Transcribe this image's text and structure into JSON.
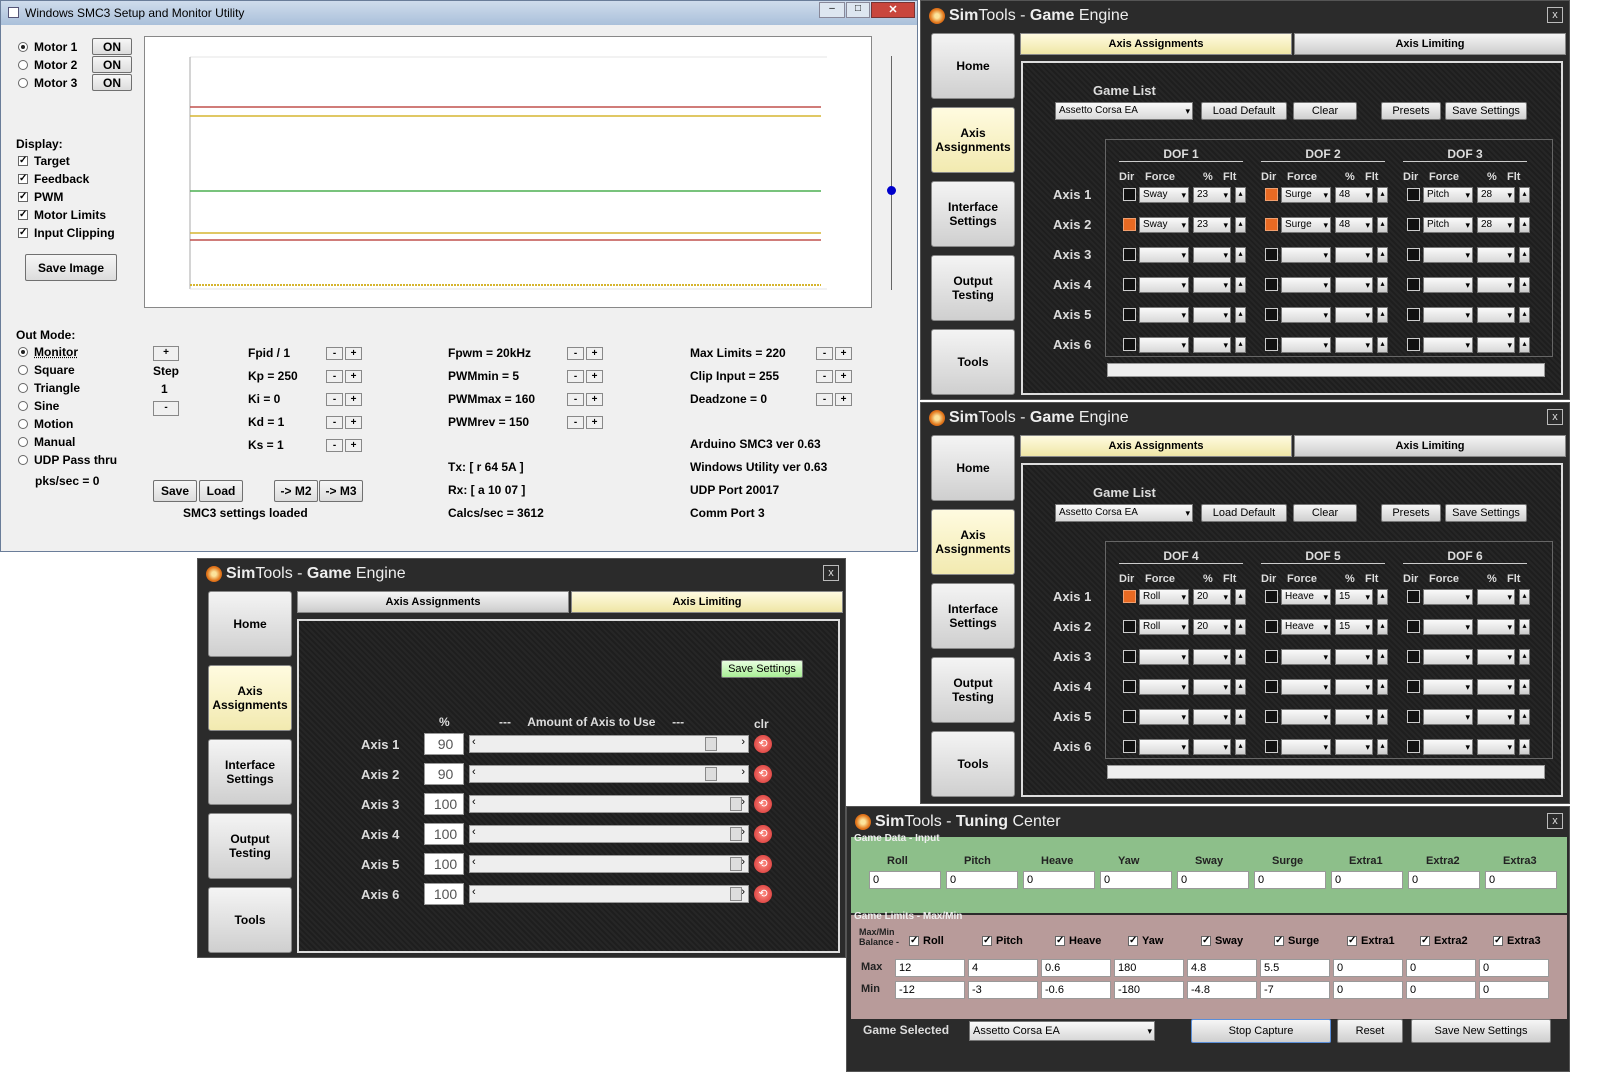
{
  "smc3": {
    "title": "Windows SMC3 Setup and Monitor Utility",
    "motors": [
      {
        "label": "Motor 1",
        "state": "ON",
        "selected": true
      },
      {
        "label": "Motor 2",
        "state": "ON",
        "selected": false
      },
      {
        "label": "Motor 3",
        "state": "ON",
        "selected": false
      }
    ],
    "display_label": "Display:",
    "display_opts": [
      {
        "label": "Target",
        "checked": true
      },
      {
        "label": "Feedback",
        "checked": true
      },
      {
        "label": "PWM",
        "checked": true
      },
      {
        "label": "Motor Limits",
        "checked": true
      },
      {
        "label": "Input Clipping",
        "checked": true
      }
    ],
    "save_image": "Save Image",
    "out_mode_label": "Out Mode:",
    "out_modes": [
      {
        "label": "Monitor",
        "selected": true
      },
      {
        "label": "Square",
        "selected": false
      },
      {
        "label": "Triangle",
        "selected": false
      },
      {
        "label": "Sine",
        "selected": false
      },
      {
        "label": "Motion",
        "selected": false
      },
      {
        "label": "Manual",
        "selected": false
      },
      {
        "label": "UDP Pass thru",
        "selected": false
      }
    ],
    "pks": "pks/sec = 0",
    "step_label": "Step",
    "step_value": "1",
    "plus": "+",
    "minus": "-",
    "params_col1": [
      "Fpid / 1",
      "Kp = 250",
      "Ki = 0",
      "Kd = 1",
      "Ks = 1"
    ],
    "params_col2": [
      "Fpwm = 20kHz",
      "PWMmin = 5",
      "PWMmax = 160",
      "PWMrev = 150"
    ],
    "params_col3": [
      "Max Limits = 220",
      "Clip Input = 255",
      "Deadzone = 0"
    ],
    "info_col2": [
      "Tx: [ r 64 5A ]",
      "Rx: [ a 10 07 ]",
      "Calcs/sec = 3612"
    ],
    "info_col3": [
      "Arduino SMC3 ver 0.63",
      "Windows Utility ver 0.63",
      "UDP Port 20017",
      "Comm Port 3"
    ],
    "buttons": {
      "save": "Save",
      "load": "Load",
      "m2": "-> M2",
      "m3": "-> M3"
    },
    "status": "SMC3 settings loaded",
    "line_colors": {
      "red": "#c0504d",
      "yellow": "#d6b530",
      "green": "#4caf50",
      "slider": "#0000cc"
    }
  },
  "st_common": {
    "title_sim": "Sim",
    "title_tools": "Tools - ",
    "title_game": "Game",
    "title_engine": " Engine",
    "close": "x",
    "nav": [
      "Home",
      "Axis\nAssignments",
      "Interface\nSettings",
      "Output\nTesting",
      "Tools"
    ],
    "tabs": [
      "Axis Assignments",
      "Axis Limiting"
    ],
    "game_list": "Game List",
    "game": "Assetto Corsa EA",
    "load_default": "Load Default",
    "clear": "Clear",
    "presets": "Presets",
    "save_settings": "Save Settings",
    "col_heads": {
      "dir": "Dir",
      "force": "Force",
      "pct": "%",
      "flt": "Flt"
    },
    "axes": [
      "Axis 1",
      "Axis 2",
      "Axis 3",
      "Axis 4",
      "Axis 5",
      "Axis 6"
    ]
  },
  "st1": {
    "dofs": [
      "DOF 1",
      "DOF 2",
      "DOF 3"
    ],
    "rows": [
      [
        {
          "on": false,
          "f": "Sway",
          "p": "23"
        },
        {
          "on": true,
          "f": "Surge",
          "p": "48"
        },
        {
          "on": false,
          "f": "Pitch",
          "p": "28"
        }
      ],
      [
        {
          "on": true,
          "f": "Sway",
          "p": "23"
        },
        {
          "on": true,
          "f": "Surge",
          "p": "48"
        },
        {
          "on": false,
          "f": "Pitch",
          "p": "28"
        }
      ],
      [
        {
          "on": false,
          "f": "",
          "p": ""
        },
        {
          "on": false,
          "f": "",
          "p": ""
        },
        {
          "on": false,
          "f": "",
          "p": ""
        }
      ],
      [
        {
          "on": false,
          "f": "",
          "p": ""
        },
        {
          "on": false,
          "f": "",
          "p": ""
        },
        {
          "on": false,
          "f": "",
          "p": ""
        }
      ],
      [
        {
          "on": false,
          "f": "",
          "p": ""
        },
        {
          "on": false,
          "f": "",
          "p": ""
        },
        {
          "on": false,
          "f": "",
          "p": ""
        }
      ],
      [
        {
          "on": false,
          "f": "",
          "p": ""
        },
        {
          "on": false,
          "f": "",
          "p": ""
        },
        {
          "on": false,
          "f": "",
          "p": ""
        }
      ]
    ]
  },
  "st2": {
    "dofs": [
      "DOF 4",
      "DOF 5",
      "DOF 6"
    ],
    "rows": [
      [
        {
          "on": true,
          "f": "Roll",
          "p": "20"
        },
        {
          "on": false,
          "f": "Heave",
          "p": "15"
        },
        {
          "on": false,
          "f": "",
          "p": ""
        }
      ],
      [
        {
          "on": false,
          "f": "Roll",
          "p": "20"
        },
        {
          "on": false,
          "f": "Heave",
          "p": "15"
        },
        {
          "on": false,
          "f": "",
          "p": ""
        }
      ],
      [
        {
          "on": false,
          "f": "",
          "p": ""
        },
        {
          "on": false,
          "f": "",
          "p": ""
        },
        {
          "on": false,
          "f": "",
          "p": ""
        }
      ],
      [
        {
          "on": false,
          "f": "",
          "p": ""
        },
        {
          "on": false,
          "f": "",
          "p": ""
        },
        {
          "on": false,
          "f": "",
          "p": ""
        }
      ],
      [
        {
          "on": false,
          "f": "",
          "p": ""
        },
        {
          "on": false,
          "f": "",
          "p": ""
        },
        {
          "on": false,
          "f": "",
          "p": ""
        }
      ],
      [
        {
          "on": false,
          "f": "",
          "p": ""
        },
        {
          "on": false,
          "f": "",
          "p": ""
        },
        {
          "on": false,
          "f": "",
          "p": ""
        }
      ]
    ]
  },
  "st3": {
    "save_settings": "Save Settings",
    "pct": "%",
    "amount": "---     Amount of Axis to Use     ---",
    "clr": "clr",
    "rows": [
      {
        "axis": "Axis 1",
        "pct": "90",
        "level": 0.9
      },
      {
        "axis": "Axis 2",
        "pct": "90",
        "level": 0.9
      },
      {
        "axis": "Axis 3",
        "pct": "100",
        "level": 1.0
      },
      {
        "axis": "Axis 4",
        "pct": "100",
        "level": 1.0
      },
      {
        "axis": "Axis 5",
        "pct": "100",
        "level": 1.0
      },
      {
        "axis": "Axis 6",
        "pct": "100",
        "level": 1.0
      }
    ]
  },
  "tc": {
    "title_sim": "Sim",
    "title_tools": "Tools - ",
    "title_tuning": "Tuning",
    "title_center": " Center",
    "close": "x",
    "input_label": "Game Data - Input",
    "limits_label": "Game Limits - Max/Min",
    "channels": [
      "Roll",
      "Pitch",
      "Heave",
      "Yaw",
      "Sway",
      "Surge",
      "Extra1",
      "Extra2",
      "Extra3"
    ],
    "inputs": [
      "0",
      "0",
      "0",
      "0",
      "0",
      "0",
      "0",
      "0",
      "0"
    ],
    "balance_label": "Max/Min\nBalance -",
    "max_label": "Max",
    "min_label": "Min",
    "max": [
      "12",
      "4",
      "0.6",
      "180",
      "4.8",
      "5.5",
      "0",
      "0",
      "0"
    ],
    "min": [
      "-12",
      "-3",
      "-0.6",
      "-180",
      "-4.8",
      "-7",
      "0",
      "0",
      "0"
    ],
    "game_selected": "Game Selected",
    "game": "Assetto Corsa EA",
    "stop": "Stop Capture",
    "reset": "Reset",
    "save_new": "Save New Settings"
  }
}
